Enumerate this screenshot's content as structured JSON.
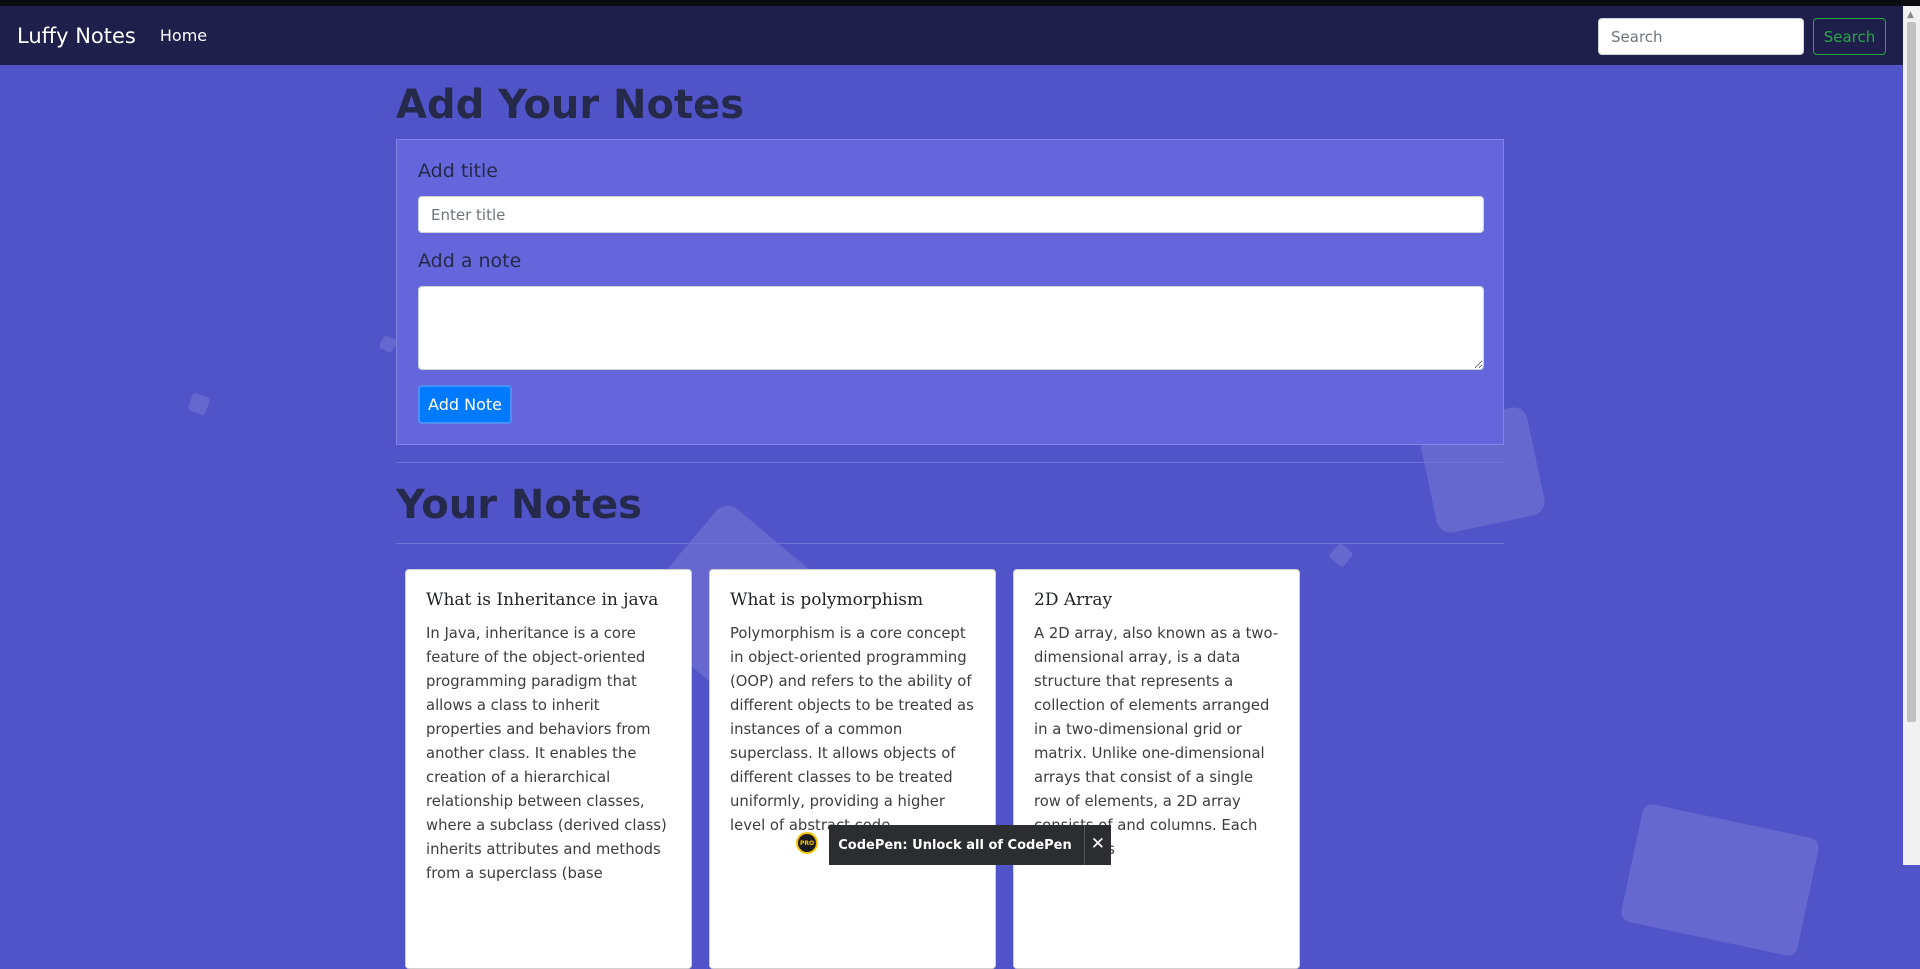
{
  "navbar": {
    "brand": "Luffy Notes",
    "home_label": "Home",
    "search_placeholder": "Search",
    "search_button_label": "Search"
  },
  "add_section": {
    "heading": "Add Your Notes",
    "title_label": "Add title",
    "title_placeholder": "Enter title",
    "note_label": "Add a note",
    "note_value": "",
    "add_button_label": "Add Note"
  },
  "notes_section": {
    "heading": "Your Notes",
    "notes": [
      {
        "title": "What is Inheritance in java",
        "text": "In Java, inheritance is a core feature of the object-oriented programming paradigm that allows a class to inherit properties and behaviors from another class. It enables the creation of a hierarchical relationship between classes, where a subclass (derived class) inherits attributes and methods from a superclass (base"
      },
      {
        "title": "What is polymorphism",
        "text": "Polymorphism is a core concept in object-oriented programming (OOP) and refers to the ability of different objects to be treated as instances of a common superclass. It allows objects of different classes to be treated uniformly, providing a higher level of abstract code."
      },
      {
        "title": "2D Array",
        "text": "A 2D array, also known as a two-dimensional array, is a data structure that represents a collection of elements arranged in a two-dimensional grid or matrix. Unlike one-dimensional arrays that consist of a single row of elements, a 2D array consists of and columns. Each 2D array is"
      }
    ]
  },
  "codepen_banner": {
    "text": "CodePen: Unlock all of CodePen",
    "badge": "PRO",
    "close": "✕"
  },
  "colors": {
    "page_background": "#5153c9",
    "navbar": "#1e1f4b",
    "form_panel": "#6566dc",
    "primary_button": "#007bff",
    "search_button": "#28a745"
  }
}
